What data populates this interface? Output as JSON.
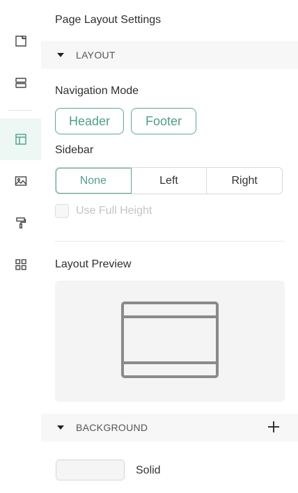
{
  "sidebar": {
    "items": [
      {
        "icon": "page-settings-icon"
      },
      {
        "icon": "sections-icon"
      },
      {
        "icon": "layout-icon",
        "active": true
      },
      {
        "icon": "image-icon"
      },
      {
        "icon": "paint-roller-icon"
      },
      {
        "icon": "grid-apps-icon"
      }
    ]
  },
  "page": {
    "title": "Page Layout Settings"
  },
  "layout_section": {
    "label": "LAYOUT",
    "navigation_mode": {
      "label": "Navigation Mode",
      "options": [
        "Header",
        "Footer"
      ]
    },
    "sidebar": {
      "label": "Sidebar",
      "options": [
        "None",
        "Left",
        "Right"
      ],
      "selected": "None"
    },
    "full_height": {
      "label": "Use Full Height",
      "checked": false,
      "disabled": true
    },
    "preview": {
      "label": "Layout Preview"
    }
  },
  "background_section": {
    "label": "BACKGROUND",
    "type_label": "Solid"
  },
  "colors": {
    "accent": "#4f9f8b",
    "accent_bg": "#edf7f3"
  }
}
